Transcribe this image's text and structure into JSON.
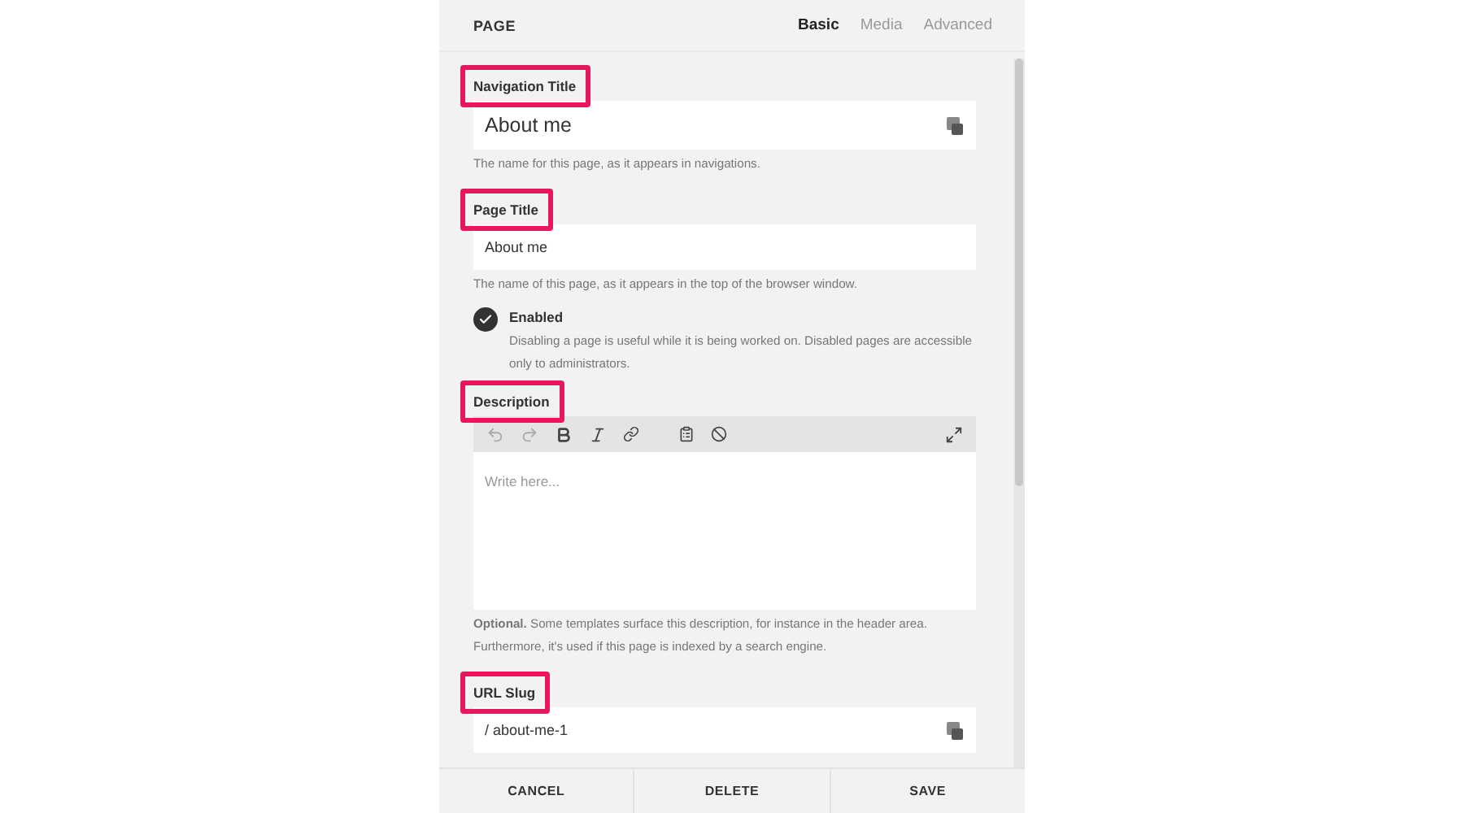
{
  "header": {
    "title": "PAGE",
    "tabs": [
      {
        "label": "Basic",
        "selected": true
      },
      {
        "label": "Media",
        "selected": false
      },
      {
        "label": "Advanced",
        "selected": false
      }
    ]
  },
  "sections": [
    {
      "kind": "large_text",
      "label": "Navigation Title",
      "highlighted": true,
      "value": "About me",
      "has_icon": true,
      "help": "The name for this page, as it appears in navigations."
    },
    {
      "kind": "text",
      "label": "Page Title",
      "highlighted": true,
      "value": "About me",
      "has_icon": false,
      "help": "The name of this page, as it appears in the top of the browser window."
    },
    {
      "kind": "toggle",
      "label": "Enabled",
      "checked": true,
      "help": "Disabling a page is useful while it is being worked on. Disabled pages are accessible only to administrators."
    },
    {
      "kind": "richtext",
      "label": "Description",
      "highlighted": true,
      "placeholder": "Write here...",
      "help": "**Optional.** Some templates surface this description, for instance in the header area. Furthermore, it's used if this page is indexed by a search engine."
    },
    {
      "kind": "text",
      "label": "URL Slug",
      "highlighted": true,
      "value": "/ about-me-1",
      "has_icon": true
    }
  ],
  "footer": {
    "buttons": [
      "CANCEL",
      "DELETE",
      "SAVE"
    ]
  }
}
